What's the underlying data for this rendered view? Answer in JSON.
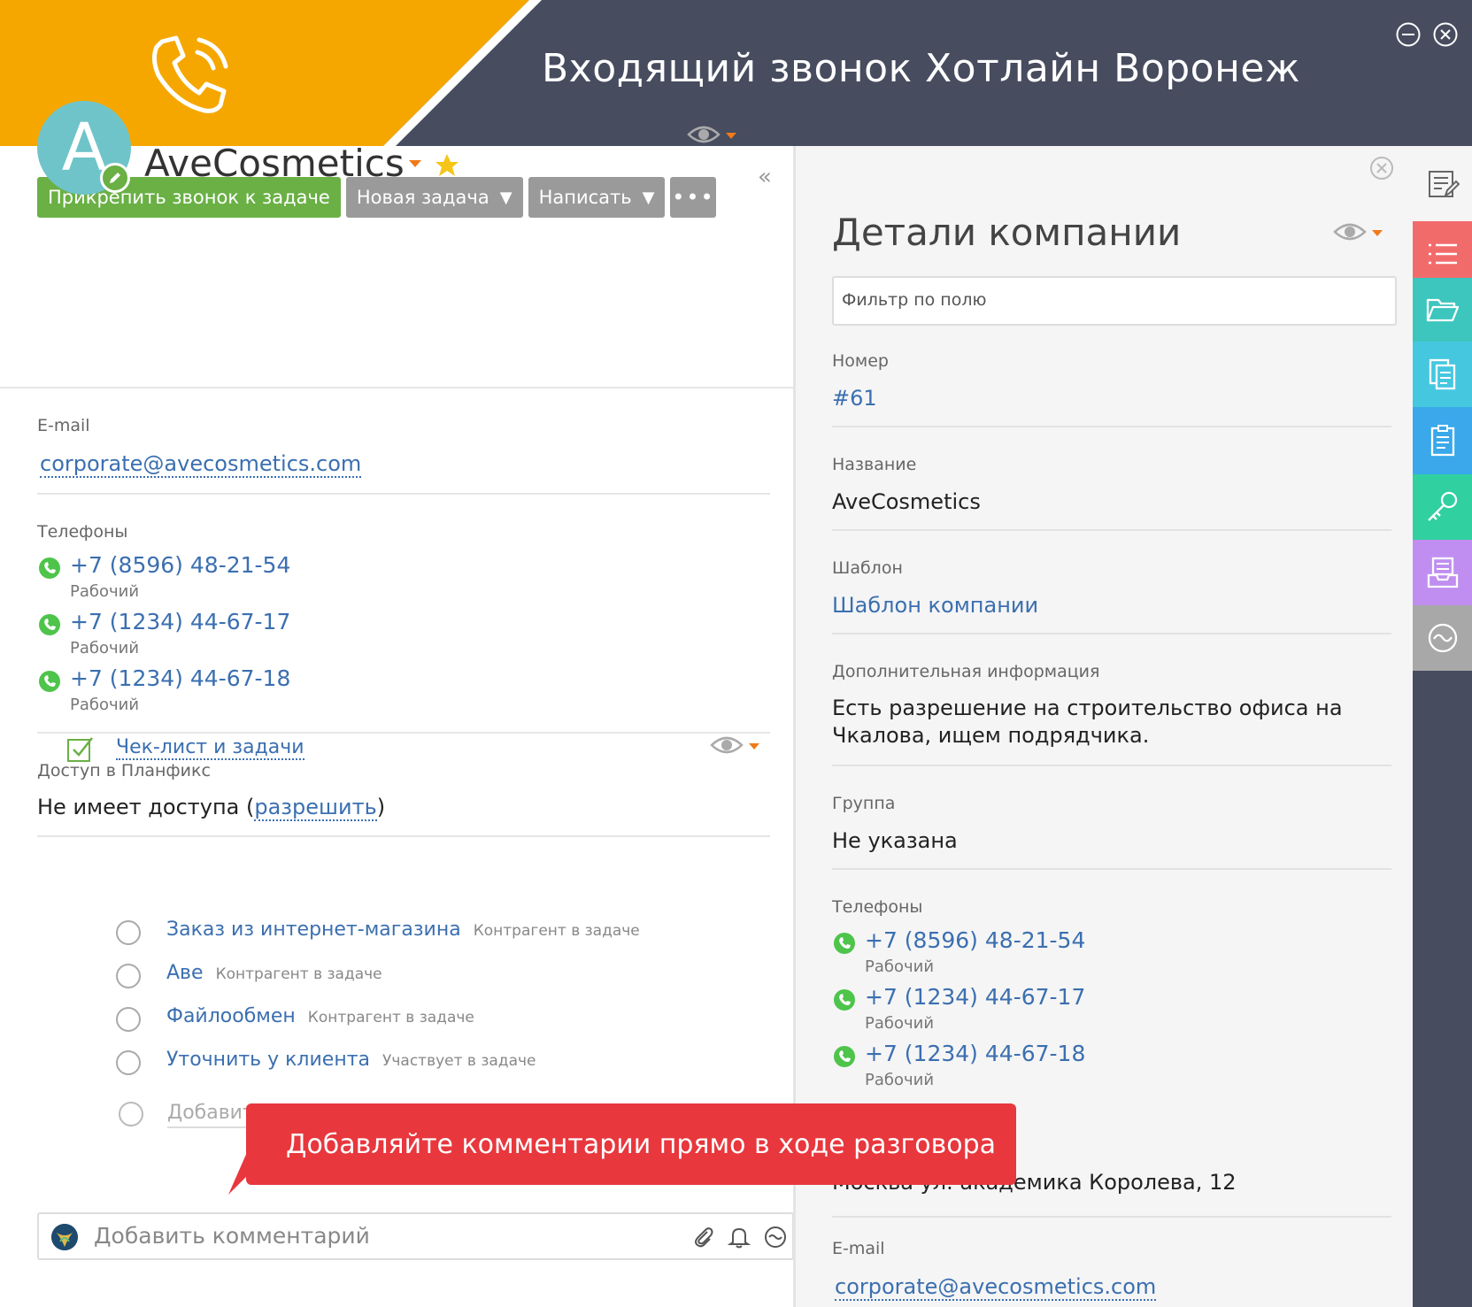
{
  "header": {
    "title_incoming": "Входящий звонок",
    "title_line": "Хотлайн Воронеж",
    "colors": {
      "orange": "#f5a700",
      "dark": "#474c5f"
    },
    "icons": [
      "phone-ringing-icon",
      "minimize-icon",
      "close-icon"
    ]
  },
  "toolbar": {
    "attach_label": "Прикрепить звонок к задаче",
    "new_task_label": "Новая задача",
    "write_label": "Написать",
    "more_label": "•••",
    "caret": "▼",
    "collapse": "«"
  },
  "contact": {
    "avatar_letter": "A",
    "name": "AveCosmetics",
    "email_label": "E-mail",
    "email": "corporate@avecosmetics.com",
    "phones_label": "Телефоны",
    "phones": [
      {
        "number": "+7 (8596) 48-21-54",
        "type": "Рабочий"
      },
      {
        "number": "+7 (1234) 44-67-17",
        "type": "Рабочий"
      },
      {
        "number": "+7 (1234) 44-67-18",
        "type": "Рабочий"
      }
    ],
    "access_label": "Доступ в Планфикс",
    "access_text": "Не имеет доступа (",
    "access_link": "разрешить",
    "access_close": ")"
  },
  "checklist": {
    "title": "Чек-лист и задачи",
    "tasks": [
      {
        "name": "Заказ из интернет-магазина",
        "role": "Контрагент в задаче"
      },
      {
        "name": "Аве",
        "role": "Контрагент в задаче"
      },
      {
        "name": "Файлообмен",
        "role": "Контрагент в задаче"
      },
      {
        "name": "Уточнить у клиента",
        "role": "Участвует в задаче"
      }
    ],
    "add_placeholder": "Добавить"
  },
  "comment": {
    "placeholder": "Добавить комментарий"
  },
  "tooltip": {
    "text": "Добавляйте комментарии прямо в ходе разговора",
    "color": "#e8373d"
  },
  "details": {
    "title": "Детали компании",
    "filter_placeholder": "Фильтр по полю",
    "number_label": "Номер",
    "number": "#61",
    "name_label": "Название",
    "name": "AveCosmetics",
    "template_label": "Шаблон",
    "template": "Шаблон компании",
    "extra_label": "Дополнительная информация",
    "extra_line1": "Есть разрешение на строительство офиса на",
    "extra_line2": "Чкалова, ищем подрядчика.",
    "group_label": "Группа",
    "group": "Не указана",
    "phones_label": "Телефоны",
    "phones": [
      {
        "number": "+7 (8596) 48-21-54",
        "type": "Рабочий"
      },
      {
        "number": "+7 (1234) 44-67-17",
        "type": "Рабочий"
      },
      {
        "number": "+7 (1234) 44-67-18",
        "type": "Рабочий"
      }
    ],
    "address": "Москва ул. академика Королева, 12",
    "email_label": "E-mail",
    "email": "corporate@avecosmetics.com"
  },
  "sidebar": {
    "items": [
      {
        "icon": "edit-note-icon",
        "color": "#f5f5f5"
      },
      {
        "icon": "list-icon",
        "color": "#f26b6b"
      },
      {
        "icon": "folder-icon",
        "color": "#3cc6bd"
      },
      {
        "icon": "documents-icon",
        "color": "#45c7e0"
      },
      {
        "icon": "clipboard-icon",
        "color": "#3aa8ea"
      },
      {
        "icon": "key-icon",
        "color": "#30d0a0"
      },
      {
        "icon": "inbox-icon",
        "color": "#c08ef0"
      },
      {
        "icon": "wave-icon",
        "color": "#a8a8a8"
      }
    ]
  }
}
